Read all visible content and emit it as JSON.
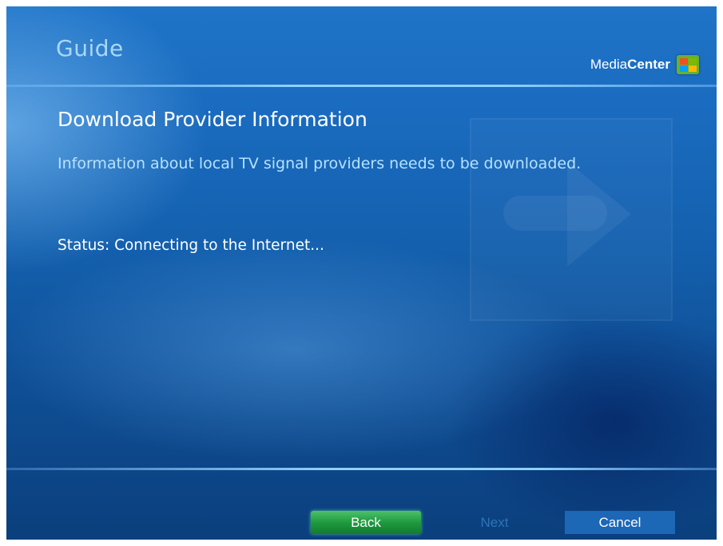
{
  "header": {
    "title": "Guide",
    "brand_part1": "Media",
    "brand_part2": "Center",
    "brand_icon": "windows-logo-icon"
  },
  "main": {
    "title": "Download Provider Information",
    "info": "Information about local TV signal providers needs to be downloaded.",
    "status": "Status: Connecting to the Internet..."
  },
  "footer": {
    "back_label": "Back",
    "next_label": "Next",
    "cancel_label": "Cancel"
  },
  "colors": {
    "background": "#1460ae",
    "accent_line": "#8fd0ff",
    "back_button": "#1e9a3f",
    "next_disabled": "#2c74b8",
    "cancel_button": "#1c67b6"
  }
}
